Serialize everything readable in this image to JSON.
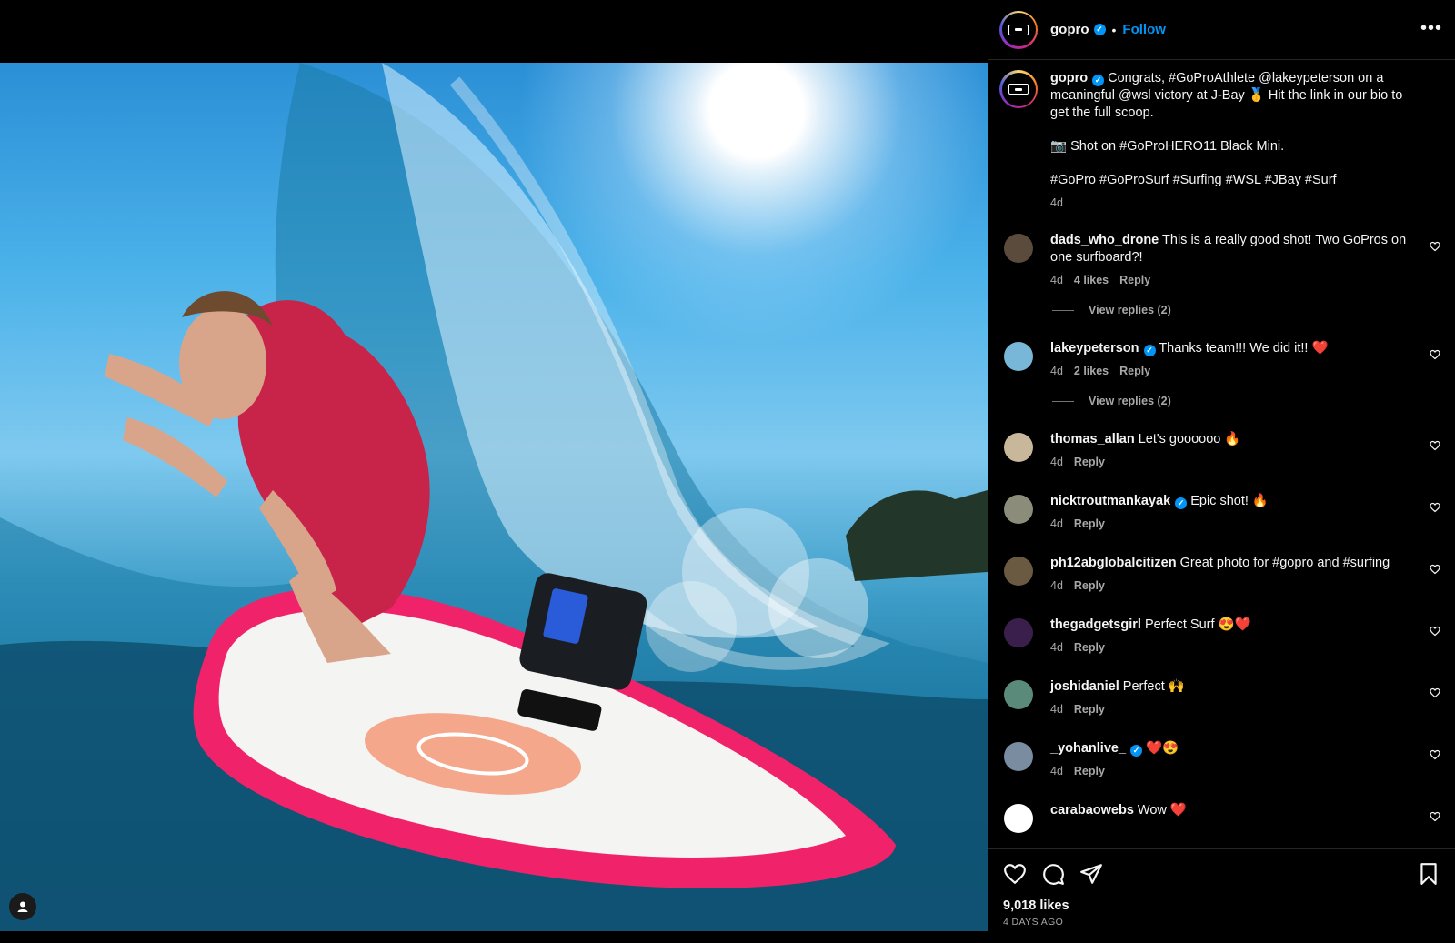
{
  "header": {
    "username": "gopro",
    "separator": "•",
    "follow_label": "Follow",
    "more_label": "•••"
  },
  "caption": {
    "username": "gopro",
    "line1": "Congrats, #GoProAthlete @lakeypeterson on a meaningful @wsl victory at J-Bay 🥇 Hit the link in our bio to get the full scoop.",
    "line2": "📷 Shot on #GoProHERO11 Black Mini.",
    "line3": "#GoPro #GoProSurf #Surfing #WSL #JBay #Surf",
    "time": "4d"
  },
  "comments": [
    {
      "username": "dads_who_drone",
      "verified": false,
      "text": "This is a really good shot! Two GoPros on one surfboard?!",
      "time": "4d",
      "likes": "4 likes",
      "reply": "Reply",
      "view_replies": "View replies (2)",
      "avatar_color": "#5a4b3c"
    },
    {
      "username": "lakeypeterson",
      "verified": true,
      "text": "Thanks team!!! We did it!! ❤️",
      "time": "4d",
      "likes": "2 likes",
      "reply": "Reply",
      "view_replies": "View replies (2)",
      "avatar_color": "#79b7d8"
    },
    {
      "username": "thomas_allan",
      "verified": false,
      "text": "Let's goooooo 🔥",
      "time": "4d",
      "reply": "Reply",
      "avatar_color": "#c8b79a"
    },
    {
      "username": "nicktroutmankayak",
      "verified": true,
      "text": "Epic shot! 🔥",
      "time": "4d",
      "reply": "Reply",
      "avatar_color": "#8c8c7a"
    },
    {
      "username": "ph12abglobalcitizen",
      "verified": false,
      "text": "Great photo for #gopro and #surfing",
      "time": "4d",
      "reply": "Reply",
      "avatar_color": "#6b5a42"
    },
    {
      "username": "thegadgetsgirl",
      "verified": false,
      "text": "Perfect Surf 😍❤️",
      "time": "4d",
      "reply": "Reply",
      "avatar_color": "#3a1f4d"
    },
    {
      "username": "joshidaniel",
      "verified": false,
      "text": "Perfect 🙌",
      "time": "4d",
      "reply": "Reply",
      "avatar_color": "#5a8a7a"
    },
    {
      "username": "_yohanlive_",
      "verified": true,
      "text": "❤️😍",
      "time": "4d",
      "reply": "Reply",
      "avatar_color": "#7a8ca0"
    },
    {
      "username": "carabaowebs",
      "verified": false,
      "text": "Wow ❤️",
      "avatar_color": "#ffffff"
    }
  ],
  "footer": {
    "likes": "9,018 likes",
    "ago": "4 DAYS AGO"
  },
  "colors": {
    "accent": "#0095f6",
    "background": "#000000",
    "secondary_text": "#a8a8a8"
  }
}
